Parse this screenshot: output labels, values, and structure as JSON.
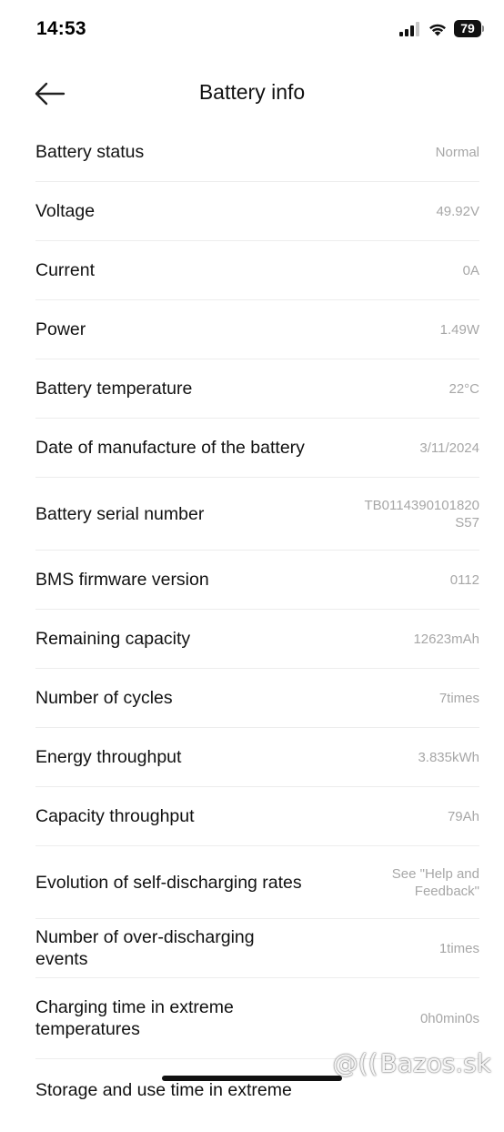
{
  "status_bar": {
    "time": "14:53",
    "battery_level": "79"
  },
  "header": {
    "title": "Battery info"
  },
  "rows": [
    {
      "label": "Battery status",
      "value": "Normal"
    },
    {
      "label": "Voltage",
      "value": "49.92V"
    },
    {
      "label": "Current",
      "value": "0A"
    },
    {
      "label": "Power",
      "value": "1.49W"
    },
    {
      "label": "Battery temperature",
      "value": "22°C"
    },
    {
      "label": "Date of manufacture of the battery",
      "value": "3/11/2024"
    },
    {
      "label": "Battery serial number",
      "value": "TB0114390101820\nS57"
    },
    {
      "label": "BMS firmware version",
      "value": "0112"
    },
    {
      "label": "Remaining capacity",
      "value": "12623mAh"
    },
    {
      "label": "Number of cycles",
      "value": "7times"
    },
    {
      "label": "Energy throughput",
      "value": "3.835kWh"
    },
    {
      "label": "Capacity throughput",
      "value": "79Ah"
    },
    {
      "label": "Evolution of self-discharging rates",
      "value": "See \"Help and\nFeedback\""
    },
    {
      "label": "Number of over-discharging events",
      "value": "1times"
    },
    {
      "label": "Charging time in extreme temperatures",
      "value": "0h0min0s"
    },
    {
      "label": "Storage and use time in extreme",
      "value": ""
    }
  ],
  "watermark": {
    "text": "Bazos.sk"
  },
  "colors": {
    "label": "#111111",
    "value": "#a7a7a7",
    "divider": "#ededed"
  }
}
